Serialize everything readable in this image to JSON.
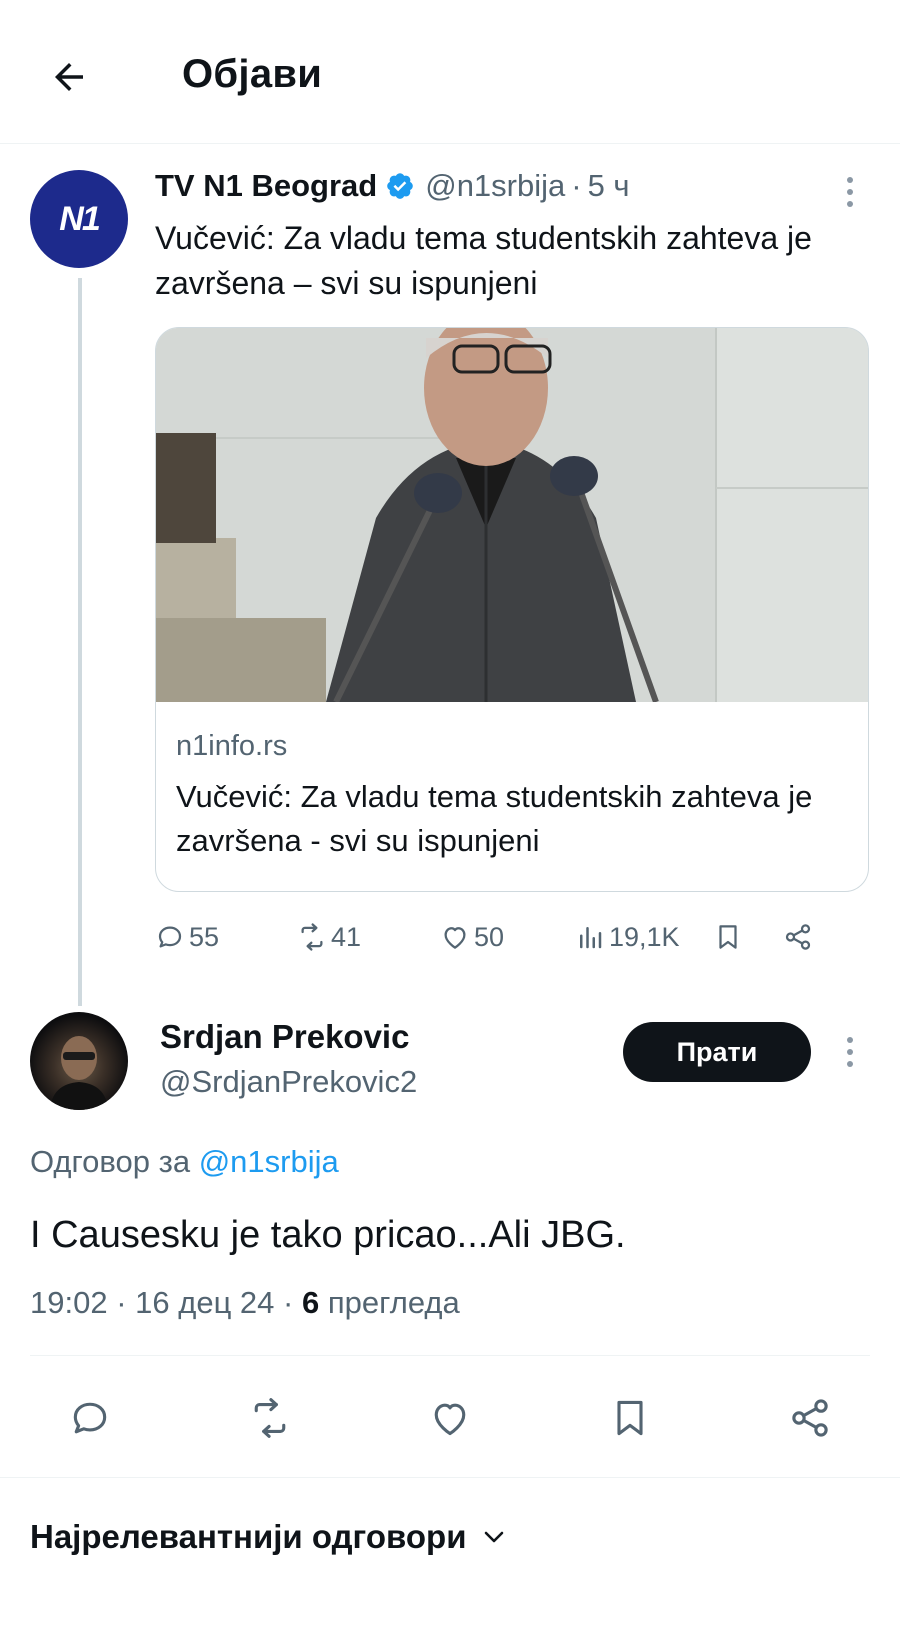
{
  "header": {
    "title": "Објави",
    "back_icon": "arrow-left-icon"
  },
  "parent_tweet": {
    "avatar_text": "N1",
    "author_name": "TV N1 Beograd",
    "verified": true,
    "handle": "@n1srbija",
    "separator": "·",
    "time": "5 ч",
    "text": "Vučević: Za vladu tema studentskih zahteva je završena – svi su ispunjeni",
    "card": {
      "domain": "n1info.rs",
      "title": "Vučević: Za vladu tema studentskih zahteva je završena - svi su ispunjeni"
    },
    "actions": {
      "replies": "55",
      "reposts": "41",
      "likes": "50",
      "views": "19,1K"
    }
  },
  "reply_tweet": {
    "author_name": "Srdjan Prekovic",
    "handle": "@SrdjanPrekovic2",
    "follow_label": "Прати",
    "replying_to_prefix": "Одговор за",
    "replying_to_handle": "@n1srbija",
    "text": "I Causesku je tako pricao...Ali JBG.",
    "time": "19:02",
    "date": "16 дец 24",
    "views_count": "6",
    "views_label": "прегледа"
  },
  "replies_sort": {
    "label": "Најрелевантнији одговори"
  },
  "colors": {
    "text": "#0f1419",
    "secondary": "#536471",
    "accent": "#1d9bf0",
    "n1_brand": "#1d2a8c"
  }
}
